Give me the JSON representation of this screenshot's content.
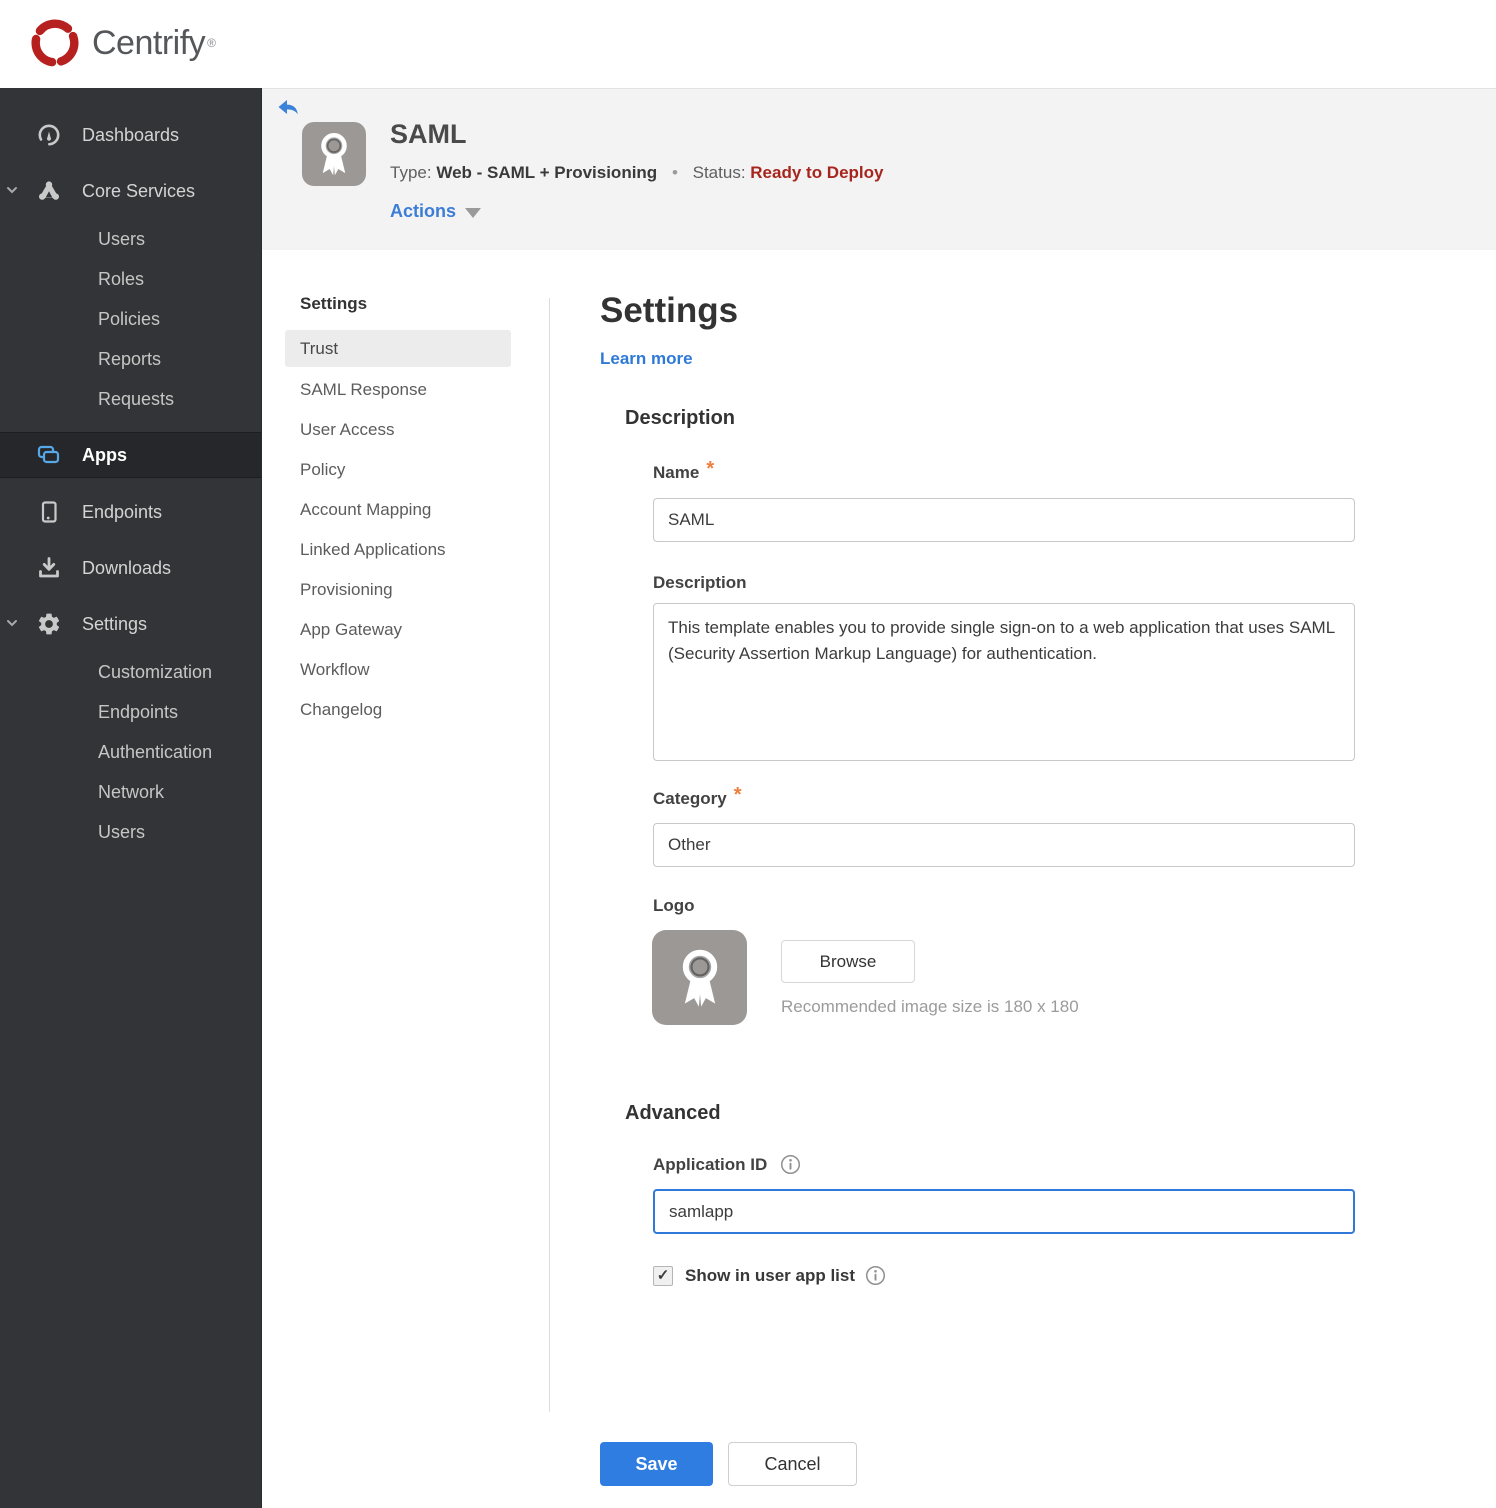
{
  "brand": {
    "name": "Centrify",
    "registered": "®"
  },
  "colors": {
    "accent_blue": "#2f7de1",
    "link_blue": "#2e7ad7",
    "status_red": "#a6261f",
    "required_orange": "#ef7d3b",
    "apps_icon_blue": "#55a9e8",
    "logo_red": "#b6201e",
    "sidebar_bg": "#333437"
  },
  "sidebar": {
    "dashboards": "Dashboards",
    "core_services": "Core Services",
    "core_children": [
      "Users",
      "Roles",
      "Policies",
      "Reports",
      "Requests"
    ],
    "apps": "Apps",
    "endpoints": "Endpoints",
    "downloads": "Downloads",
    "settings": "Settings",
    "settings_children": [
      "Customization",
      "Endpoints",
      "Authentication",
      "Network",
      "Users"
    ]
  },
  "app_header": {
    "title": "SAML",
    "type_label": "Type:",
    "type_value": "Web - SAML + Provisioning",
    "separator": "•",
    "status_label": "Status:",
    "status_value": "Ready to Deploy",
    "actions_label": "Actions"
  },
  "subnav": {
    "heading": "Settings",
    "selected": "Trust",
    "items": [
      "Trust",
      "SAML Response",
      "User Access",
      "Policy",
      "Account Mapping",
      "Linked Applications",
      "Provisioning",
      "App Gateway",
      "Workflow",
      "Changelog"
    ]
  },
  "main": {
    "title": "Settings",
    "learn_more": "Learn more",
    "required_marker": "*",
    "checkmark": "✓",
    "description": {
      "heading": "Description",
      "name_label": "Name",
      "name_value": "SAML",
      "description_label": "Description",
      "description_value": "This template enables you to provide single sign-on to a web application that uses SAML (Security Assertion Markup Language) for authentication.",
      "category_label": "Category",
      "category_value": "Other",
      "logo_label": "Logo",
      "browse_label": "Browse",
      "recommended_text": "Recommended image size is 180 x 180"
    },
    "advanced": {
      "heading": "Advanced",
      "application_id_label": "Application ID",
      "application_id_value": "samlapp",
      "show_label": "Show in user app list",
      "checkbox_checked": true
    },
    "save_label": "Save",
    "cancel_label": "Cancel"
  }
}
